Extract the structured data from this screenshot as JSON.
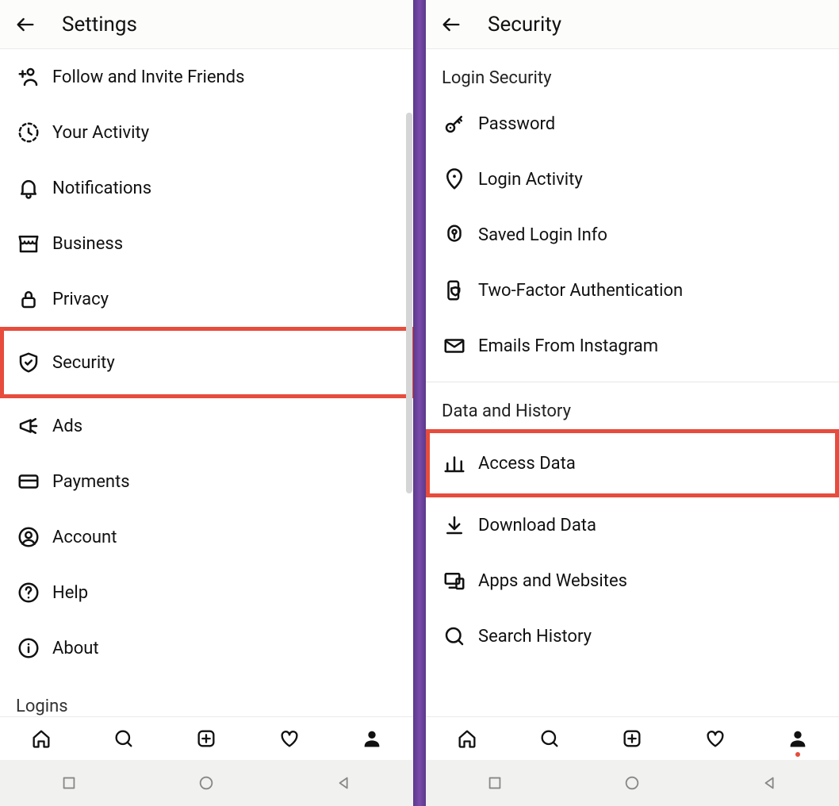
{
  "left": {
    "header_title": "Settings",
    "items": [
      {
        "name": "follow-invite",
        "label": "Follow and Invite Friends",
        "icon": "person-plus",
        "highlight": false
      },
      {
        "name": "your-activity",
        "label": "Your Activity",
        "icon": "clock-activity",
        "highlight": false
      },
      {
        "name": "notifications",
        "label": "Notifications",
        "icon": "bell",
        "highlight": false
      },
      {
        "name": "business",
        "label": "Business",
        "icon": "storefront",
        "highlight": false
      },
      {
        "name": "privacy",
        "label": "Privacy",
        "icon": "lock",
        "highlight": false
      },
      {
        "name": "security",
        "label": "Security",
        "icon": "shield-check",
        "highlight": true
      },
      {
        "name": "ads",
        "label": "Ads",
        "icon": "megaphone",
        "highlight": false
      },
      {
        "name": "payments",
        "label": "Payments",
        "icon": "credit-card",
        "highlight": false
      },
      {
        "name": "account",
        "label": "Account",
        "icon": "user-circle",
        "highlight": false
      },
      {
        "name": "help",
        "label": "Help",
        "icon": "help-circle",
        "highlight": false
      },
      {
        "name": "about",
        "label": "About",
        "icon": "info-circle",
        "highlight": false
      }
    ],
    "logins_heading": "Logins"
  },
  "right": {
    "header_title": "Security",
    "section1_heading": "Login Security",
    "section1_items": [
      {
        "name": "password",
        "label": "Password",
        "icon": "key",
        "highlight": false
      },
      {
        "name": "login-activity",
        "label": "Login Activity",
        "icon": "location-pin",
        "highlight": false
      },
      {
        "name": "saved-login-info",
        "label": "Saved Login Info",
        "icon": "keyhole",
        "highlight": false
      },
      {
        "name": "two-factor",
        "label": "Two-Factor Authentication",
        "icon": "phone-shield",
        "highlight": false
      },
      {
        "name": "emails-instagram",
        "label": "Emails From Instagram",
        "icon": "envelope",
        "highlight": false
      }
    ],
    "section2_heading": "Data and History",
    "section2_items": [
      {
        "name": "access-data",
        "label": "Access Data",
        "icon": "bar-chart",
        "highlight": true
      },
      {
        "name": "download-data",
        "label": "Download Data",
        "icon": "download",
        "highlight": false
      },
      {
        "name": "apps-websites",
        "label": "Apps and Websites",
        "icon": "devices",
        "highlight": false
      },
      {
        "name": "search-history",
        "label": "Search History",
        "icon": "search",
        "highlight": false
      }
    ]
  }
}
